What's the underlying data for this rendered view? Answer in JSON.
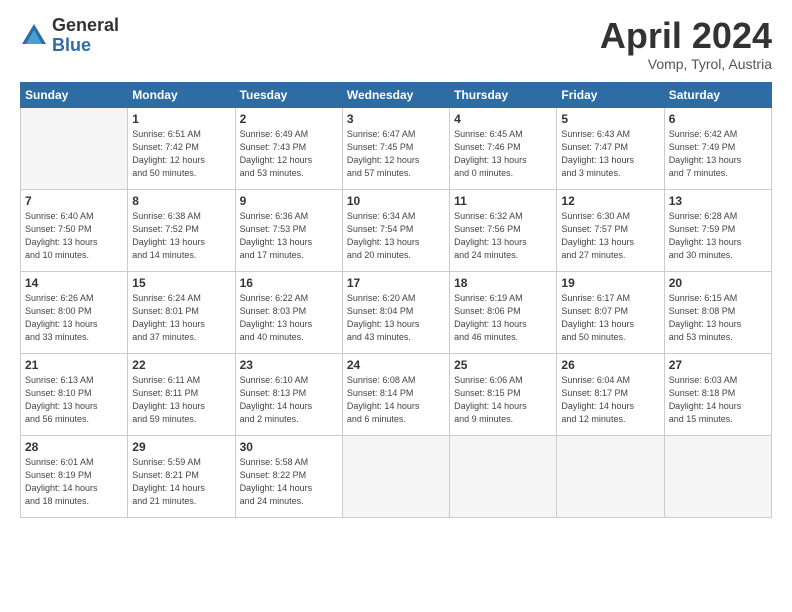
{
  "header": {
    "logo_general": "General",
    "logo_blue": "Blue",
    "month_title": "April 2024",
    "location": "Vomp, Tyrol, Austria"
  },
  "days_of_week": [
    "Sunday",
    "Monday",
    "Tuesday",
    "Wednesday",
    "Thursday",
    "Friday",
    "Saturday"
  ],
  "weeks": [
    [
      {
        "num": "",
        "info": ""
      },
      {
        "num": "1",
        "info": "Sunrise: 6:51 AM\nSunset: 7:42 PM\nDaylight: 12 hours\nand 50 minutes."
      },
      {
        "num": "2",
        "info": "Sunrise: 6:49 AM\nSunset: 7:43 PM\nDaylight: 12 hours\nand 53 minutes."
      },
      {
        "num": "3",
        "info": "Sunrise: 6:47 AM\nSunset: 7:45 PM\nDaylight: 12 hours\nand 57 minutes."
      },
      {
        "num": "4",
        "info": "Sunrise: 6:45 AM\nSunset: 7:46 PM\nDaylight: 13 hours\nand 0 minutes."
      },
      {
        "num": "5",
        "info": "Sunrise: 6:43 AM\nSunset: 7:47 PM\nDaylight: 13 hours\nand 3 minutes."
      },
      {
        "num": "6",
        "info": "Sunrise: 6:42 AM\nSunset: 7:49 PM\nDaylight: 13 hours\nand 7 minutes."
      }
    ],
    [
      {
        "num": "7",
        "info": "Sunrise: 6:40 AM\nSunset: 7:50 PM\nDaylight: 13 hours\nand 10 minutes."
      },
      {
        "num": "8",
        "info": "Sunrise: 6:38 AM\nSunset: 7:52 PM\nDaylight: 13 hours\nand 14 minutes."
      },
      {
        "num": "9",
        "info": "Sunrise: 6:36 AM\nSunset: 7:53 PM\nDaylight: 13 hours\nand 17 minutes."
      },
      {
        "num": "10",
        "info": "Sunrise: 6:34 AM\nSunset: 7:54 PM\nDaylight: 13 hours\nand 20 minutes."
      },
      {
        "num": "11",
        "info": "Sunrise: 6:32 AM\nSunset: 7:56 PM\nDaylight: 13 hours\nand 24 minutes."
      },
      {
        "num": "12",
        "info": "Sunrise: 6:30 AM\nSunset: 7:57 PM\nDaylight: 13 hours\nand 27 minutes."
      },
      {
        "num": "13",
        "info": "Sunrise: 6:28 AM\nSunset: 7:59 PM\nDaylight: 13 hours\nand 30 minutes."
      }
    ],
    [
      {
        "num": "14",
        "info": "Sunrise: 6:26 AM\nSunset: 8:00 PM\nDaylight: 13 hours\nand 33 minutes."
      },
      {
        "num": "15",
        "info": "Sunrise: 6:24 AM\nSunset: 8:01 PM\nDaylight: 13 hours\nand 37 minutes."
      },
      {
        "num": "16",
        "info": "Sunrise: 6:22 AM\nSunset: 8:03 PM\nDaylight: 13 hours\nand 40 minutes."
      },
      {
        "num": "17",
        "info": "Sunrise: 6:20 AM\nSunset: 8:04 PM\nDaylight: 13 hours\nand 43 minutes."
      },
      {
        "num": "18",
        "info": "Sunrise: 6:19 AM\nSunset: 8:06 PM\nDaylight: 13 hours\nand 46 minutes."
      },
      {
        "num": "19",
        "info": "Sunrise: 6:17 AM\nSunset: 8:07 PM\nDaylight: 13 hours\nand 50 minutes."
      },
      {
        "num": "20",
        "info": "Sunrise: 6:15 AM\nSunset: 8:08 PM\nDaylight: 13 hours\nand 53 minutes."
      }
    ],
    [
      {
        "num": "21",
        "info": "Sunrise: 6:13 AM\nSunset: 8:10 PM\nDaylight: 13 hours\nand 56 minutes."
      },
      {
        "num": "22",
        "info": "Sunrise: 6:11 AM\nSunset: 8:11 PM\nDaylight: 13 hours\nand 59 minutes."
      },
      {
        "num": "23",
        "info": "Sunrise: 6:10 AM\nSunset: 8:13 PM\nDaylight: 14 hours\nand 2 minutes."
      },
      {
        "num": "24",
        "info": "Sunrise: 6:08 AM\nSunset: 8:14 PM\nDaylight: 14 hours\nand 6 minutes."
      },
      {
        "num": "25",
        "info": "Sunrise: 6:06 AM\nSunset: 8:15 PM\nDaylight: 14 hours\nand 9 minutes."
      },
      {
        "num": "26",
        "info": "Sunrise: 6:04 AM\nSunset: 8:17 PM\nDaylight: 14 hours\nand 12 minutes."
      },
      {
        "num": "27",
        "info": "Sunrise: 6:03 AM\nSunset: 8:18 PM\nDaylight: 14 hours\nand 15 minutes."
      }
    ],
    [
      {
        "num": "28",
        "info": "Sunrise: 6:01 AM\nSunset: 8:19 PM\nDaylight: 14 hours\nand 18 minutes."
      },
      {
        "num": "29",
        "info": "Sunrise: 5:59 AM\nSunset: 8:21 PM\nDaylight: 14 hours\nand 21 minutes."
      },
      {
        "num": "30",
        "info": "Sunrise: 5:58 AM\nSunset: 8:22 PM\nDaylight: 14 hours\nand 24 minutes."
      },
      {
        "num": "",
        "info": ""
      },
      {
        "num": "",
        "info": ""
      },
      {
        "num": "",
        "info": ""
      },
      {
        "num": "",
        "info": ""
      }
    ]
  ]
}
